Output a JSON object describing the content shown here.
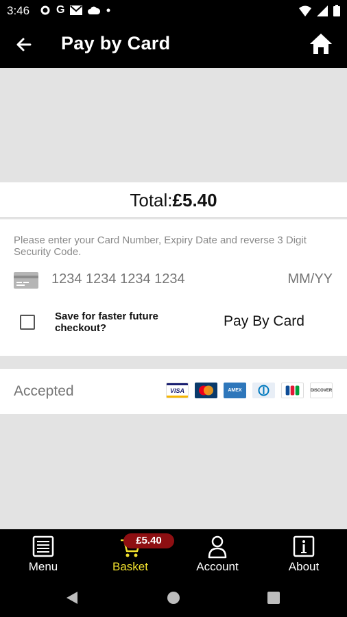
{
  "status_bar": {
    "time": "3:46",
    "icons": [
      "settings-icon",
      "google-icon",
      "gmail-icon",
      "cloud-icon",
      "dot-icon",
      "wifi-icon",
      "signal-icon",
      "battery-icon"
    ]
  },
  "app_bar": {
    "title": "Pay by Card",
    "back_icon": "arrow-left-icon",
    "home_icon": "home-icon"
  },
  "total": {
    "label": "Total:",
    "amount": "£5.40"
  },
  "payment_form": {
    "instructions": "Please enter your Card Number, Expiry Date and reverse 3 Digit Security Code.",
    "card_number_placeholder": "1234 1234 1234 1234",
    "expiry_placeholder": "MM/YY",
    "save_label": "Save for faster future checkout?",
    "pay_button_label": "Pay By Card"
  },
  "accepted": {
    "label": "Accepted",
    "cards": [
      "VISA",
      "MasterCard",
      "AMEX",
      "Diners Club",
      "JCB",
      "DISCOVER"
    ]
  },
  "bottom_nav": {
    "items": [
      {
        "label": "Menu",
        "icon": "menu-book-icon",
        "active": false
      },
      {
        "label": "Basket",
        "icon": "basket-icon",
        "active": true,
        "badge": "£5.40"
      },
      {
        "label": "Account",
        "icon": "account-icon",
        "active": false
      },
      {
        "label": "About",
        "icon": "info-icon",
        "active": false
      }
    ]
  },
  "colors": {
    "app_bar": "#000000",
    "background": "#e3e3e3",
    "active_nav": "#f2e12e",
    "badge": "#8e0f12"
  }
}
